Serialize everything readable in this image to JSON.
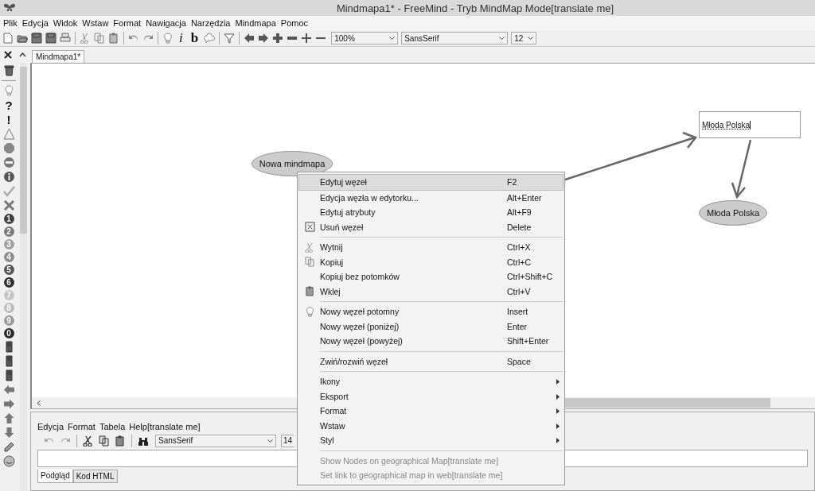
{
  "window": {
    "title": "Mindmapa1* - FreeMind - Tryb MindMap Mode[translate me]"
  },
  "menu_bar": [
    "Plik",
    "Edycja",
    "Widok",
    "Wstaw",
    "Format",
    "Nawigacja",
    "Narzędzia",
    "Mindmapa",
    "Pomoc"
  ],
  "toolbar": {
    "items": [
      {
        "kind": "new"
      },
      {
        "kind": "open"
      },
      {
        "kind": "save"
      },
      {
        "kind": "save"
      },
      {
        "kind": "print"
      },
      {
        "kind": "sep"
      },
      {
        "kind": "cut"
      },
      {
        "kind": "copy"
      },
      {
        "kind": "paste"
      },
      {
        "kind": "sep"
      },
      {
        "kind": "undo"
      },
      {
        "kind": "redo"
      },
      {
        "kind": "sep"
      },
      {
        "kind": "bulb"
      },
      {
        "kind": "italic",
        "label": "i"
      },
      {
        "kind": "bold",
        "label": "b"
      },
      {
        "kind": "cloud"
      },
      {
        "kind": "sep"
      },
      {
        "kind": "filter"
      },
      {
        "kind": "sep"
      },
      {
        "kind": "left"
      },
      {
        "kind": "right"
      },
      {
        "kind": "plus"
      },
      {
        "kind": "minus"
      },
      {
        "kind": "plus-thin"
      },
      {
        "kind": "minus-thin"
      }
    ],
    "zoom": "100%",
    "font": "SansSerif",
    "size": "12"
  },
  "icon_toolbar": [
    {
      "kind": "trash"
    },
    {
      "kind": "sep"
    },
    {
      "kind": "bulb"
    },
    {
      "kind": "glyph",
      "label": "?"
    },
    {
      "kind": "glyph",
      "label": "!"
    },
    {
      "kind": "warning"
    },
    {
      "kind": "stop"
    },
    {
      "kind": "minus-circle"
    },
    {
      "kind": "info"
    },
    {
      "kind": "check"
    },
    {
      "kind": "cross"
    },
    {
      "kind": "number",
      "label": "1",
      "color": "#404040"
    },
    {
      "kind": "number",
      "label": "2",
      "color": "#7a7a7a"
    },
    {
      "kind": "number",
      "label": "3",
      "color": "#a0a0a0"
    },
    {
      "kind": "number",
      "label": "4",
      "color": "#8c8c8c"
    },
    {
      "kind": "number",
      "label": "5",
      "color": "#555555"
    },
    {
      "kind": "number",
      "label": "6",
      "color": "#2e2e2e"
    },
    {
      "kind": "number",
      "label": "7",
      "color": "#c4c4c4"
    },
    {
      "kind": "number",
      "label": "8",
      "color": "#bdbdbd"
    },
    {
      "kind": "number",
      "label": "9",
      "color": "#9a9a9a"
    },
    {
      "kind": "number",
      "label": "0",
      "color": "#2a2a2a"
    },
    {
      "kind": "light"
    },
    {
      "kind": "light"
    },
    {
      "kind": "light"
    },
    {
      "kind": "left"
    },
    {
      "kind": "right"
    },
    {
      "kind": "up"
    },
    {
      "kind": "down"
    },
    {
      "kind": "pencil"
    },
    {
      "kind": "smiley"
    }
  ],
  "tabs": [
    {
      "label": "Mindmapa1*",
      "selected": true
    }
  ],
  "map": {
    "nodes": [
      {
        "kind": "ellipse",
        "text": "Nowa mindmapa"
      },
      {
        "kind": "editing",
        "text": "Młoda Polska"
      },
      {
        "kind": "ellipse",
        "text": "Młoda Polska"
      }
    ]
  },
  "context_menu": {
    "groups": [
      [
        {
          "label": "Edytuj węzeł",
          "shortcut": "F2",
          "selected": true
        },
        {
          "label": "Edycja węzła w edytorku...",
          "shortcut": "Alt+Enter",
          "selected": false
        },
        {
          "label": "Edytuj atrybuty",
          "shortcut": "Alt+F9",
          "selected": false
        },
        {
          "label": "Usuń węzeł",
          "shortcut": "Delete",
          "selected": false
        }
      ],
      [
        {
          "label": "Wytnij",
          "shortcut": "Ctrl+X",
          "selected": false
        },
        {
          "label": "Kopiuj",
          "shortcut": "Ctrl+C",
          "selected": false
        },
        {
          "label": "Kopiuj bez potomków",
          "shortcut": "Ctrl+Shift+C",
          "selected": false
        },
        {
          "label": "Wklej",
          "shortcut": "Ctrl+V",
          "selected": false
        }
      ],
      [
        {
          "label": "Nowy węzeł potomny",
          "shortcut": "Insert",
          "selected": false
        },
        {
          "label": "Nowy węzeł (poniżej)",
          "shortcut": "Enter",
          "selected": false
        },
        {
          "label": "Nowy węzeł (powyżej)",
          "shortcut": "Shift+Enter",
          "selected": false
        }
      ],
      [
        {
          "label": "Zwiń/rozwiń węzeł",
          "shortcut": "Space",
          "selected": false
        }
      ],
      [
        {
          "label": "Ikony",
          "submenu": true,
          "selected": false
        },
        {
          "label": "Eksport",
          "submenu": true,
          "selected": false
        },
        {
          "label": "Format",
          "submenu": true,
          "selected": false
        },
        {
          "label": "Wstaw",
          "submenu": true,
          "selected": false
        },
        {
          "label": "Styl",
          "submenu": true,
          "selected": false
        }
      ],
      [
        {
          "label": "Show Nodes on geographical Map[translate me]",
          "disabled": true,
          "selected": false
        },
        {
          "label": "Set link to geographical map in web[translate me]",
          "disabled": true,
          "selected": false
        }
      ]
    ]
  },
  "editor": {
    "menu": [
      "Edycja",
      "Format",
      "Tabela",
      "Help[translate me]"
    ],
    "tools": [
      {
        "kind": "undo"
      },
      {
        "kind": "redo"
      },
      {
        "kind": "sep"
      },
      {
        "kind": "cut"
      },
      {
        "kind": "copy"
      },
      {
        "kind": "paste"
      },
      {
        "kind": "sep"
      },
      {
        "kind": "binoculars"
      }
    ],
    "font": "SansSerif",
    "size": "14",
    "tabs": [
      {
        "label": "Podgląd",
        "selected": true
      },
      {
        "label": "Kod HTML",
        "selected": false
      }
    ]
  }
}
